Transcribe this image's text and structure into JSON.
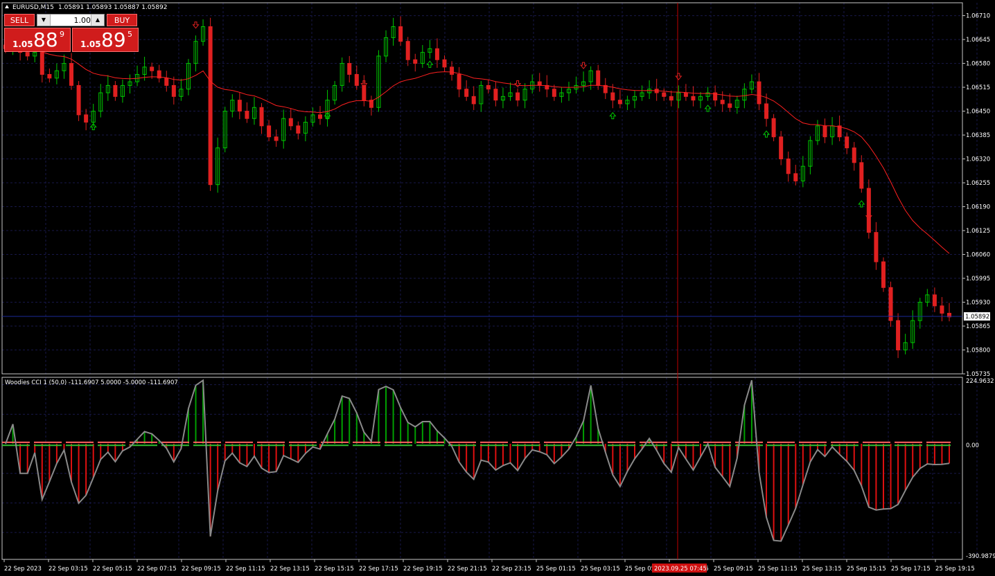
{
  "window": {
    "symbol_title": "EURUSD,M15",
    "ohlc": "1.05891 1.05893 1.05887 1.05892"
  },
  "trade_panel": {
    "sell_label": "SELL",
    "buy_label": "BUY",
    "lot_value": "1.00",
    "sell_price": {
      "small": "1.05",
      "big": "88",
      "sup": "9"
    },
    "buy_price": {
      "small": "1.05",
      "big": "89",
      "sup": "5"
    }
  },
  "price_axis": {
    "labels": [
      "1.06710",
      "1.06645",
      "1.06580",
      "1.06515",
      "1.06450",
      "1.06385",
      "1.06320",
      "1.06255",
      "1.06190",
      "1.06125",
      "1.06060",
      "1.05995",
      "1.05930",
      "1.05865",
      "1.05800",
      "1.05735"
    ],
    "current_price": "1.05892"
  },
  "indicator": {
    "title": "Woodies CCI 1 (50,0) -111.6907 5.0000 -5.0000 -111.6907",
    "axis_top": "224.9632",
    "axis_zero": "0.00",
    "axis_bottom": "-390.9879"
  },
  "time_axis": {
    "labels": [
      "22 Sep 2023",
      "22 Sep 03:15",
      "22 Sep 05:15",
      "22 Sep 07:15",
      "22 Sep 09:15",
      "22 Sep 11:15",
      "22 Sep 13:15",
      "22 Sep 15:15",
      "22 Sep 17:15",
      "22 Sep 19:15",
      "22 Sep 21:15",
      "22 Sep 23:15",
      "25 Sep 01:15",
      "25 Sep 03:15",
      "25 Sep 05:15",
      "25 Sep 07:15",
      "25 Sep 09:15",
      "25 Sep 11:15",
      "25 Sep 13:15",
      "25 Sep 15:15",
      "25 Sep 17:15",
      "25 Sep 19:15"
    ],
    "crosshair_label": "2023.09.25 07:45"
  },
  "colors": {
    "background": "#000000",
    "bull_candle": "#00c800",
    "bear_candle": "#e02020",
    "moving_average": "#ff2020",
    "cci_line": "#808080",
    "histogram_negative": "#e01010",
    "histogram_positive": "#00a000",
    "histogram_trigger": "#ffff00",
    "grid": "#18184a",
    "crosshair": "#c00000",
    "up_arrow": "#00c800",
    "down_arrow": "#e02020"
  },
  "chart_data": {
    "type": "candlestick",
    "symbol": "EURUSD",
    "timeframe": "M15",
    "ylim": [
      1.05735,
      1.06745
    ],
    "candles_close_approx": [
      1.0662,
      1.0663,
      1.0661,
      1.066,
      1.0661,
      1.0655,
      1.0654,
      1.0656,
      1.0658,
      1.0652,
      1.0644,
      1.0642,
      1.0645,
      1.065,
      1.0652,
      1.0649,
      1.0652,
      1.0653,
      1.0655,
      1.0657,
      1.0656,
      1.0654,
      1.0652,
      1.0649,
      1.0651,
      1.0658,
      1.0664,
      1.0668,
      1.0625,
      1.0635,
      1.0645,
      1.0648,
      1.0645,
      1.0643,
      1.0646,
      1.0641,
      1.0638,
      1.0637,
      1.0643,
      1.0641,
      1.0639,
      1.0642,
      1.0644,
      1.0643,
      1.0648,
      1.0652,
      1.0658,
      1.0655,
      1.0652,
      1.0648,
      1.0646,
      1.066,
      1.0665,
      1.0668,
      1.0664,
      1.0659,
      1.0658,
      1.0661,
      1.0662,
      1.0659,
      1.0657,
      1.0655,
      1.0651,
      1.0649,
      1.0647,
      1.0652,
      1.0651,
      1.0648,
      1.0649,
      1.065,
      1.0648,
      1.0651,
      1.0653,
      1.0652,
      1.0651,
      1.0649,
      1.065,
      1.0651,
      1.0652,
      1.0653,
      1.0656,
      1.0652,
      1.065,
      1.0648,
      1.0647,
      1.0648,
      1.0649,
      1.065,
      1.0651,
      1.065,
      1.0649,
      1.0648,
      1.065,
      1.0649,
      1.0648,
      1.0649,
      1.065,
      1.0648,
      1.0647,
      1.0646,
      1.0648,
      1.0651,
      1.0653,
      1.0647,
      1.0643,
      1.0638,
      1.0632,
      1.0628,
      1.0626,
      1.063,
      1.0637,
      1.0641,
      1.0638,
      1.0641,
      1.0638,
      1.0635,
      1.0631,
      1.0624,
      1.0612,
      1.0604,
      1.0597,
      1.0588,
      1.058,
      1.0582,
      1.0588,
      1.0593,
      1.0595,
      1.0592,
      1.059,
      1.0589
    ],
    "indicator": {
      "name": "Woodies CCI",
      "ylim": [
        -390.9879,
        224.9632
      ],
      "levels": [
        5.0,
        -5.0
      ],
      "last_value": -111.6907
    }
  }
}
